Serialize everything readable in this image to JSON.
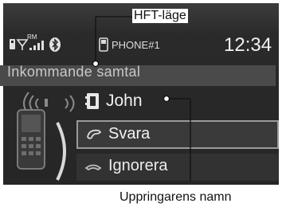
{
  "status_bar": {
    "signal_label": "RM",
    "icons": [
      "phone-status-icon",
      "signal-strength-icon",
      "bluetooth-icon",
      "phone-icon"
    ],
    "phone_name": "PHONE#1",
    "clock": "12:34"
  },
  "incoming_call": {
    "title": "Inkommande samtal",
    "caller_name": "John",
    "icons": [
      "phone-ringing-icon",
      "contact-card-icon",
      "handset-answer-icon",
      "handset-hangup-icon"
    ]
  },
  "menu": {
    "items": [
      {
        "label": "Svara",
        "selected": true
      },
      {
        "label": "Ignorera",
        "selected": false
      }
    ]
  },
  "callouts": {
    "top": "HFT-läge",
    "bottom": "Uppringarens namn"
  },
  "colors": {
    "screen_bg": "#2a2a2a",
    "text": "#f0f0f0",
    "highlight_border": "#9a9a9a"
  }
}
